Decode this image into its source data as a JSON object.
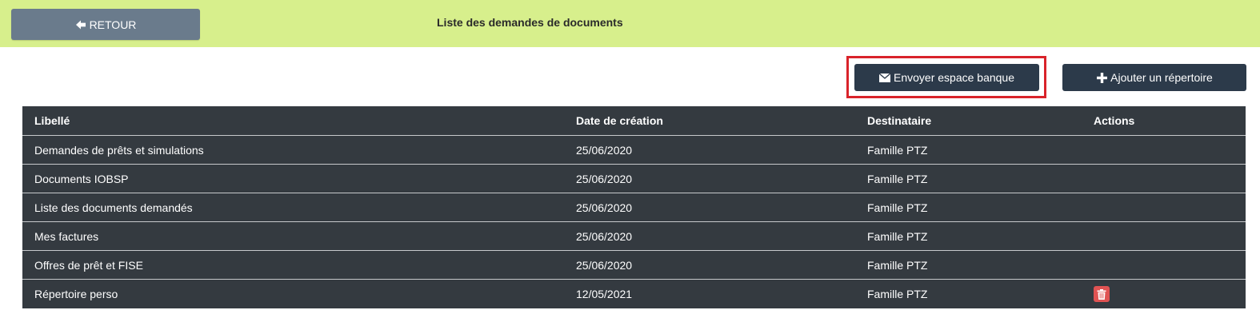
{
  "topbar": {
    "back_label": "RETOUR",
    "title": "Liste des demandes de documents"
  },
  "toolbar": {
    "send_label": "Envoyer espace banque",
    "add_label": "Ajouter un répertoire"
  },
  "table": {
    "headers": [
      "Libellé",
      "Date de création",
      "Destinataire",
      "Actions"
    ],
    "rows": [
      {
        "label": "Demandes de prêts et simulations",
        "date": "25/06/2020",
        "recipient": "Famille PTZ"
      },
      {
        "label": "Documents IOBSP",
        "date": "25/06/2020",
        "recipient": "Famille PTZ"
      },
      {
        "label": "Liste des documents demandés",
        "date": "25/06/2020",
        "recipient": "Famille PTZ"
      },
      {
        "label": "Mes factures",
        "date": "25/06/2020",
        "recipient": "Famille PTZ"
      },
      {
        "label": "Offres de prêt et FISE",
        "date": "25/06/2020",
        "recipient": "Famille PTZ"
      },
      {
        "label": "Répertoire perso",
        "date": "12/05/2021",
        "recipient": "Famille PTZ"
      }
    ]
  },
  "colors": {
    "topbar": "#d7ef8c",
    "back_button": "#6a7b8c",
    "dark_button": "#2c3a4a",
    "table_bg": "#343a40",
    "highlight": "#d9232a",
    "delete": "#e05353"
  },
  "icons": {
    "back": "arrow-left-icon",
    "send": "envelope-icon",
    "add": "plus-icon",
    "delete": "trash-icon"
  }
}
